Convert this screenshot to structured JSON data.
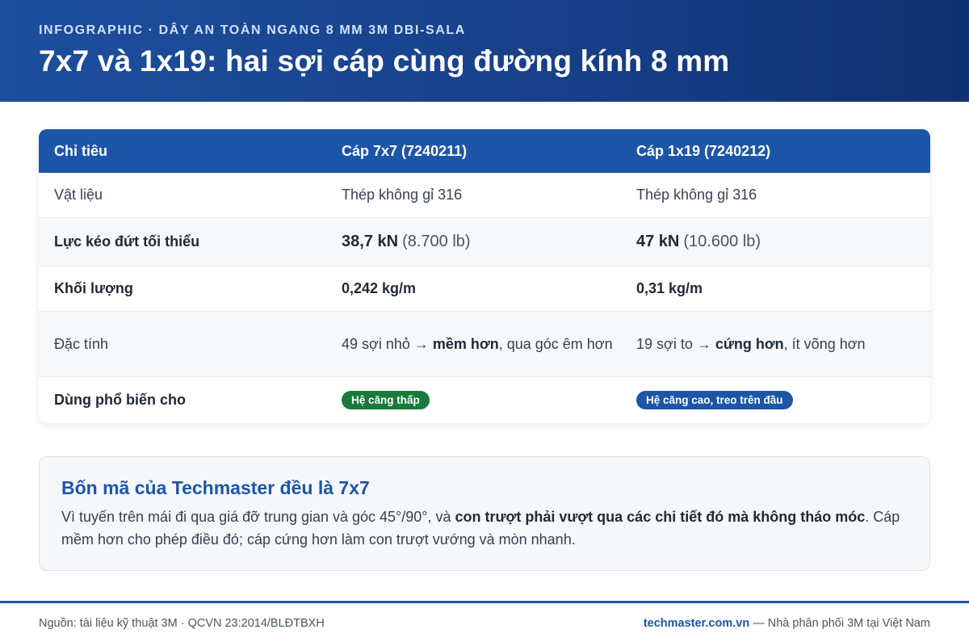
{
  "header": {
    "kicker": "INFOGRAPHIC · DÂY AN TOÀN NGANG 8 MM 3M DBI-SALA",
    "title": "7x7 và 1x19: hai sợi cáp cùng đường kính 8 mm"
  },
  "table": {
    "columns": [
      "Chỉ tiêu",
      "Cáp 7x7 (7240211)",
      "Cáp 1x19 (7240212)"
    ],
    "rows": {
      "material": {
        "label": "Vật liệu",
        "a": "Thép không gỉ 316",
        "b": "Thép không gỉ 316"
      },
      "breaking": {
        "label": "Lực kéo đứt tối thiểu",
        "a_main": "38,7 kN",
        "a_paren": "(8.700 lb)",
        "b_main": "47 kN",
        "b_paren": "(10.600 lb)"
      },
      "weight": {
        "label": "Khối lượng",
        "a": "0,242 kg/m",
        "b": "0,31 kg/m"
      },
      "traits": {
        "label": "Đặc tính",
        "a_pre": "49 sợi nhỏ → ",
        "a_strong": "mềm hơn",
        "a_post": ", qua góc êm hơn",
        "b_pre": "19 sợi to → ",
        "b_strong": "cứng hơn",
        "b_post": ", ít võng hơn"
      },
      "usage": {
        "label": "Dùng phổ biến cho",
        "a": "Hệ căng thấp",
        "b": "Hệ căng cao, treo trên đầu"
      }
    }
  },
  "note": {
    "title": "Bốn mã của Techmaster đều là 7x7",
    "pre": "Vì tuyến trên mái đi qua giá đỡ trung gian và góc 45°/90°, và ",
    "strong": "con trượt phải vượt qua các chi tiết đó mà không tháo móc",
    "post": ". Cáp mềm hơn cho phép điều đó; cáp cứng hơn làm con trượt vướng và mòn nhanh."
  },
  "footer": {
    "source": "Nguồn: tài liệu kỹ thuật 3M · QCVN 23:2014/BLĐTBXH",
    "site": "techmaster.com.vn",
    "tagline": " — Nhà phân phối 3M tại Việt Nam"
  },
  "colors": {
    "brand_blue": "#1d55a8",
    "pill_green": "#187a3b"
  }
}
